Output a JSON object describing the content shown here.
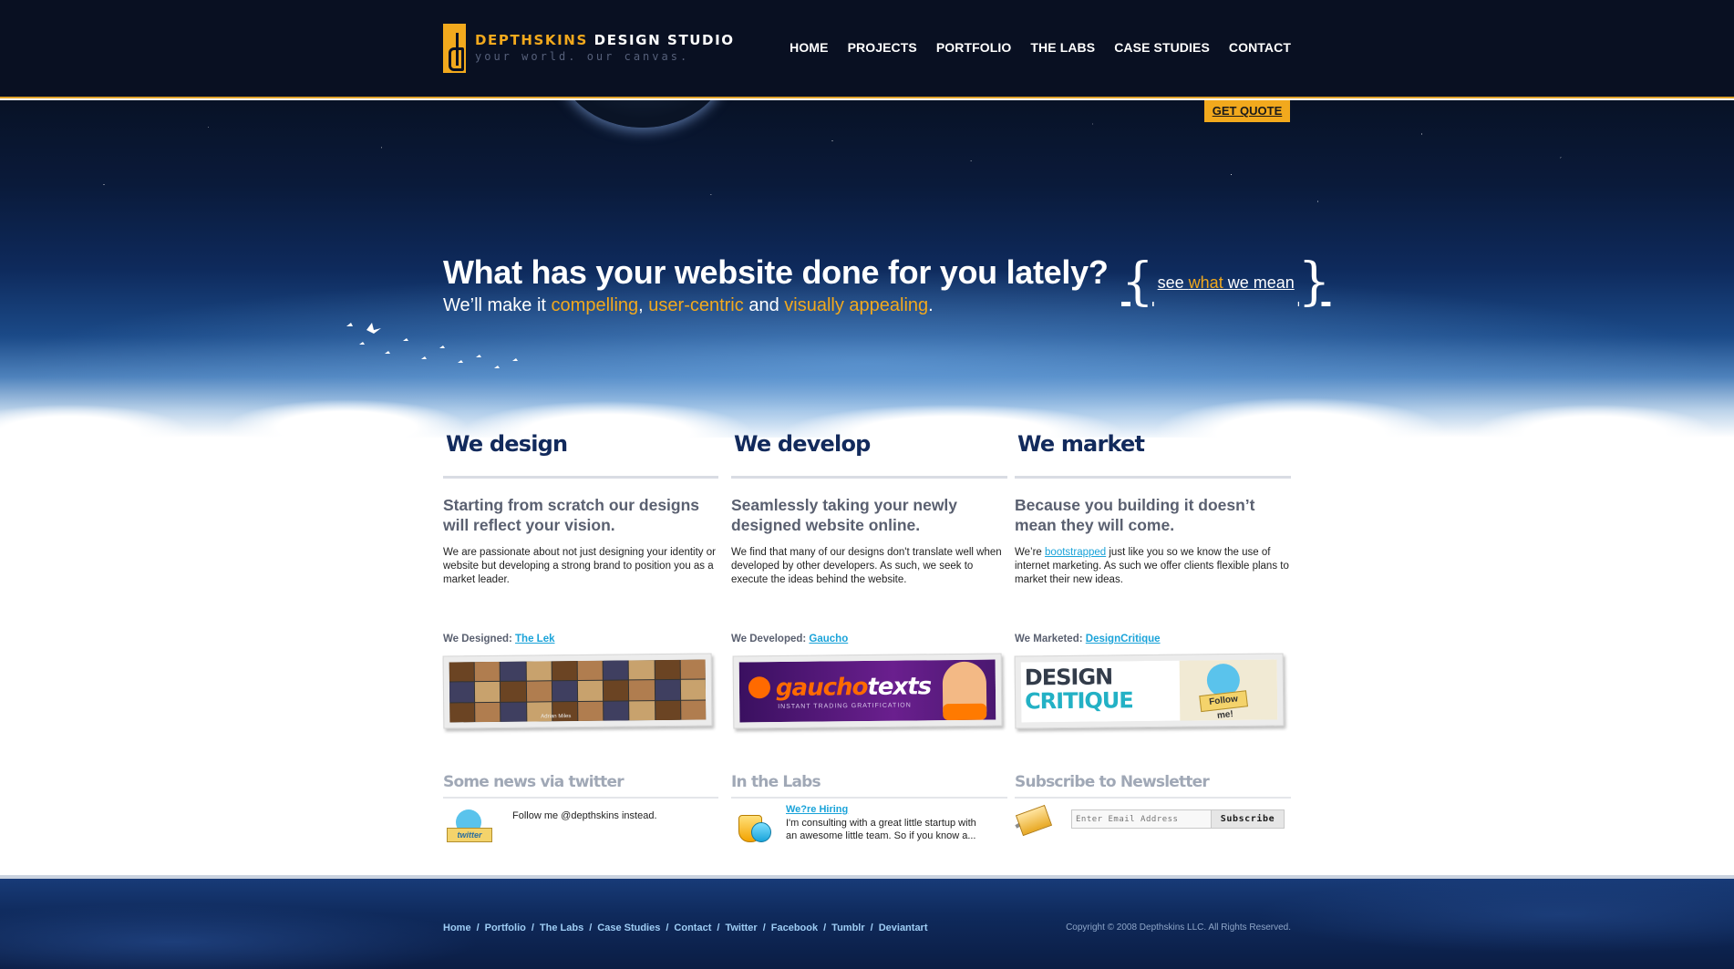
{
  "header": {
    "logo_brand": "DEPTHSKINS",
    "logo_studio": "DESIGN STUDIO",
    "logo_tagline": "your world. our canvas.",
    "nav": [
      "HOME",
      "PROJECTS",
      "PORTFOLIO",
      "THE LABS",
      "CASE STUDIES",
      "CONTACT"
    ],
    "get_quote": "GET QUOTE"
  },
  "hero": {
    "headline": "What has your website done for you lately?",
    "sub_start": "We’ll make it ",
    "sub_h1": "compelling",
    "sub_comma": ", ",
    "sub_h2": "user-centric",
    "sub_and": " and ",
    "sub_h3": "visually appealing",
    "sub_end": ".",
    "see_open": "{",
    "see_1": "see ",
    "see_2": "what",
    "see_3": " we mean",
    "see_close": "}"
  },
  "columns": [
    {
      "title": "We design",
      "lead": "Starting from scratch our designs will reflect your vision.",
      "body": "We are passionate about not just designing your identity or website but developing a strong brand to position you as a market leader.",
      "featured_label": "We Designed: ",
      "featured_link": "The Lek",
      "thumb_caption": "Adrian Miles"
    },
    {
      "title": "We develop",
      "lead": "Seamlessly taking your newly designed website online.",
      "body": "We find that many of our designs don't translate well when developed by other developers. As such, we seek to execute the ideas behind the website.",
      "featured_label": "We Developed: ",
      "featured_link": "Gaucho",
      "thumb_logo_a": "gaucho",
      "thumb_logo_b": "texts",
      "thumb_tagline": "INSTANT TRADING GRATIFICATION"
    },
    {
      "title": "We market",
      "lead": "Because you building it doesn’t mean they will come.",
      "body_before": "We’re ",
      "body_link": "bootstrapped",
      "body_after": " just like you so we know the use of internet marketing. As such we offer clients flexible plans to market their new ideas.",
      "featured_label": "We Marketed: ",
      "featured_link": "DesignCritique",
      "thumb_word1": "DESIGN",
      "thumb_word2": "CRITIQUE",
      "thumb_sign": "Follow me!"
    }
  ],
  "lower": {
    "twitter": {
      "title": "Some news via twitter",
      "icon_label": "twitter",
      "text": "Follow me @depthskins instead."
    },
    "labs": {
      "title": "In the Labs",
      "heading": "We?re Hiring",
      "text": "I'm consulting with a great little startup with an awesome little team. So if you know a..."
    },
    "newsletter": {
      "title": "Subscribe to Newsletter",
      "placeholder": "Enter Email Address",
      "button": "Subscribe"
    }
  },
  "footer": {
    "links": [
      "Home",
      "Portfolio",
      "The Labs",
      "Case Studies",
      "Contact",
      "Twitter",
      "Facebook",
      "Tumblr",
      "Deviantart"
    ],
    "separator": "/",
    "copyright": "Copyright © 2008 Depthskins LLC. All Rights Reserved."
  },
  "colors": {
    "accent": "#f2a91d",
    "header_bg": "#091022",
    "heading_blue": "#122a5c",
    "link_blue": "#1aa3d9"
  }
}
